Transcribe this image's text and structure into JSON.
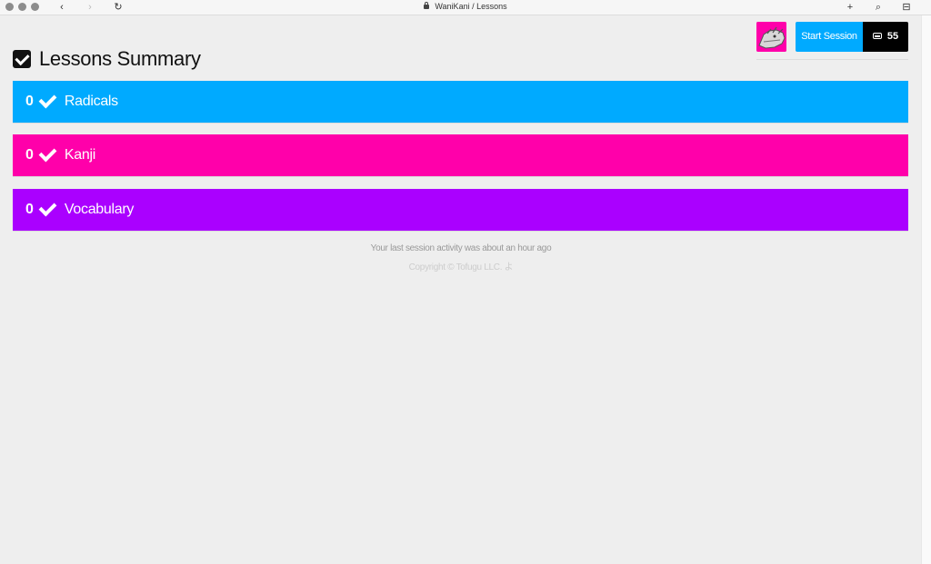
{
  "browser": {
    "address": "WaniKani / Lessons",
    "back_icon": "‹",
    "forward_icon": "›",
    "reload_icon": "↻",
    "new_tab_icon": "+",
    "search_icon": "⌕",
    "sidebar_icon": "⊟"
  },
  "header": {
    "title": "Lessons Summary",
    "start_session_label": "Start Session",
    "inbox_count": "55"
  },
  "groups": [
    {
      "count": "0",
      "label": "Radicals",
      "color": "#00aaff"
    },
    {
      "count": "0",
      "label": "Kanji",
      "color": "#ff00aa"
    },
    {
      "count": "0",
      "label": "Vocabulary",
      "color": "#aa00ff"
    }
  ],
  "footer": {
    "activity": "Your last session activity was about an hour ago",
    "copyright": "Copyright © Tofugu LLC. よ"
  }
}
